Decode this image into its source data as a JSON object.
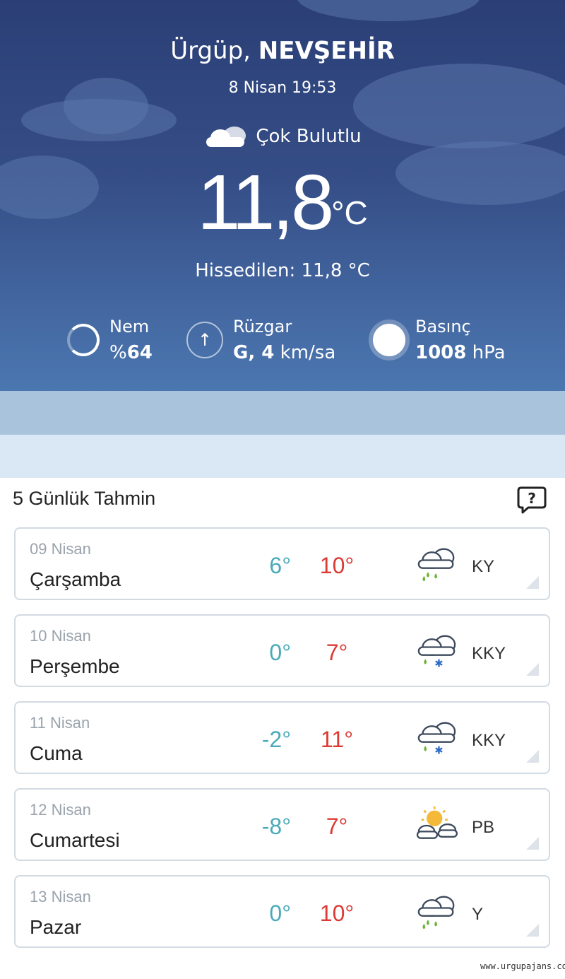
{
  "location": {
    "town": "Ürgüp, ",
    "province": "NEVŞEHİR"
  },
  "datetime": "8 Nisan 19:53",
  "condition": {
    "text": "Çok Bulutlu",
    "icon": "cloud-icon"
  },
  "temperature": {
    "value": "11,8",
    "unit": "°C"
  },
  "feels_like": "Hissedilen: 11,8 °C",
  "stats": {
    "humidity": {
      "label": "Nem",
      "prefix": "%",
      "value": "64",
      "icon": "humidity-ring-icon"
    },
    "wind": {
      "label": "Rüzgar",
      "value": "G, 4",
      "unit": " km/sa",
      "icon": "wind-arrow-icon"
    },
    "pressure": {
      "label": "Basınç",
      "value": "1008",
      "unit": " hPa",
      "icon": "pressure-circle-icon"
    }
  },
  "forecast": {
    "title": "5 Günlük Tahmin",
    "help_icon": "help-icon",
    "days": [
      {
        "date": "09 Nisan",
        "day": "Çarşamba",
        "min": "6°",
        "max": "10°",
        "code": "KY",
        "icon": "rain-cloud-icon"
      },
      {
        "date": "10 Nisan",
        "day": "Perşembe",
        "min": "0°",
        "max": "7°",
        "code": "KKY",
        "icon": "sleet-cloud-icon"
      },
      {
        "date": "11 Nisan",
        "day": "Cuma",
        "min": "-2°",
        "max": "11°",
        "code": "KKY",
        "icon": "sleet-cloud-icon"
      },
      {
        "date": "12 Nisan",
        "day": "Cumartesi",
        "min": "-8°",
        "max": "7°",
        "code": "PB",
        "icon": "partly-sunny-icon"
      },
      {
        "date": "13 Nisan",
        "day": "Pazar",
        "min": "0°",
        "max": "10°",
        "code": "Y",
        "icon": "rain-cloud-icon"
      }
    ]
  },
  "colors": {
    "min_temp": "#4aaab9",
    "max_temp": "#dc3a34",
    "hero_top": "#2b3f76",
    "hero_bottom": "#4b77b0"
  },
  "watermark": "www.urgupajans.com"
}
